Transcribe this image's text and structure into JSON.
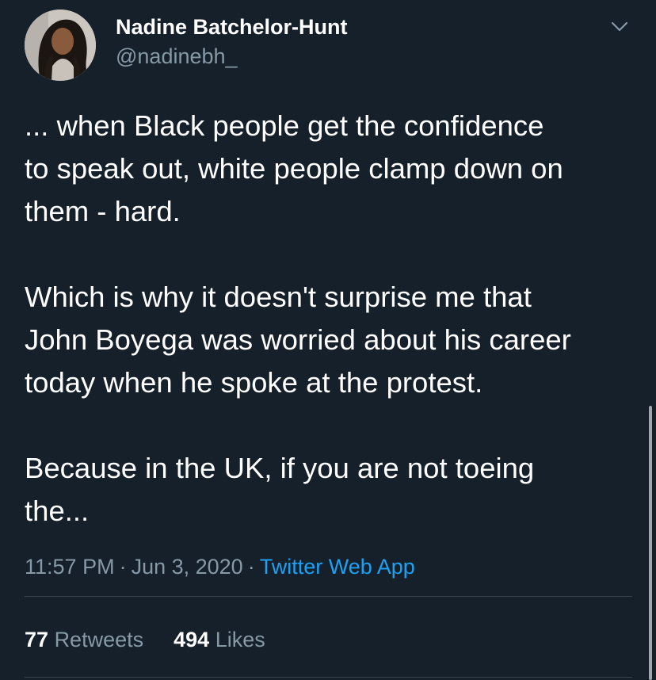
{
  "author": {
    "name": "Nadine Batchelor-Hunt",
    "handle": "@nadinebh_"
  },
  "tweet": {
    "paragraphs": [
      "... when Black people get the confidence\nto speak out, white people clamp down on\nthem - hard.",
      "Which is why it doesn't surprise me that\nJohn Boyega was worried about his career\ntoday when he spoke at the protest.",
      "Because in the UK, if you are not toeing\nthe..."
    ]
  },
  "meta": {
    "time": "11:57 PM",
    "separator": "·",
    "date": "Jun 3, 2020",
    "source": "Twitter Web App"
  },
  "stats": {
    "retweets_count": "77",
    "retweets_label": "Retweets",
    "likes_count": "494",
    "likes_label": "Likes"
  },
  "icons": {
    "menu": "chevron-down-icon"
  },
  "colors": {
    "background": "#15202b",
    "text_primary": "#ffffff",
    "text_secondary": "#8899a6",
    "link": "#1da1f2",
    "divider": "#38444d"
  }
}
